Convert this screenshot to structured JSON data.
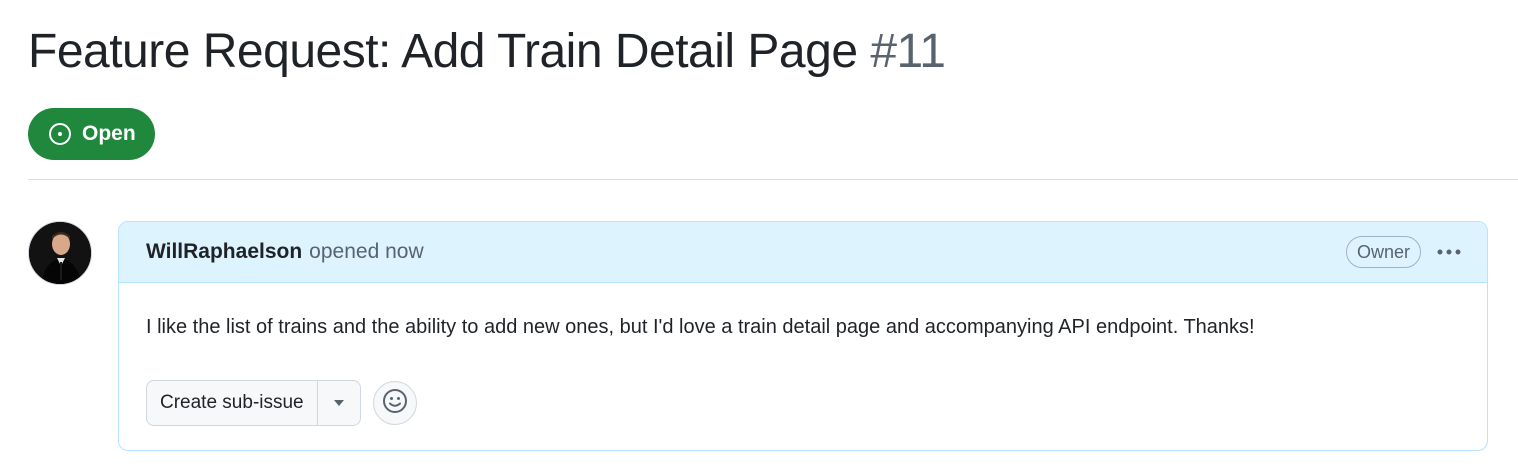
{
  "issue": {
    "title": "Feature Request: Add Train Detail Page",
    "number": "#11",
    "state": "Open",
    "state_icon": "issue-opened-icon",
    "state_color": "#1f883d"
  },
  "comment": {
    "author": "WillRaphaelson",
    "timestamp": "opened now",
    "role": "Owner",
    "more_icon": "kebab-horizontal-icon",
    "body": "I like the list of trains and the ability to add new ones, but I'd love a train detail page and accompanying API endpoint. Thanks!",
    "header_color": "#ddf4ff",
    "border_color": "#b6e3ff"
  },
  "actions": {
    "create_sub_issue_label": "Create sub-issue",
    "dropdown_icon": "triangle-down-icon",
    "reaction_icon": "smiley-icon"
  }
}
